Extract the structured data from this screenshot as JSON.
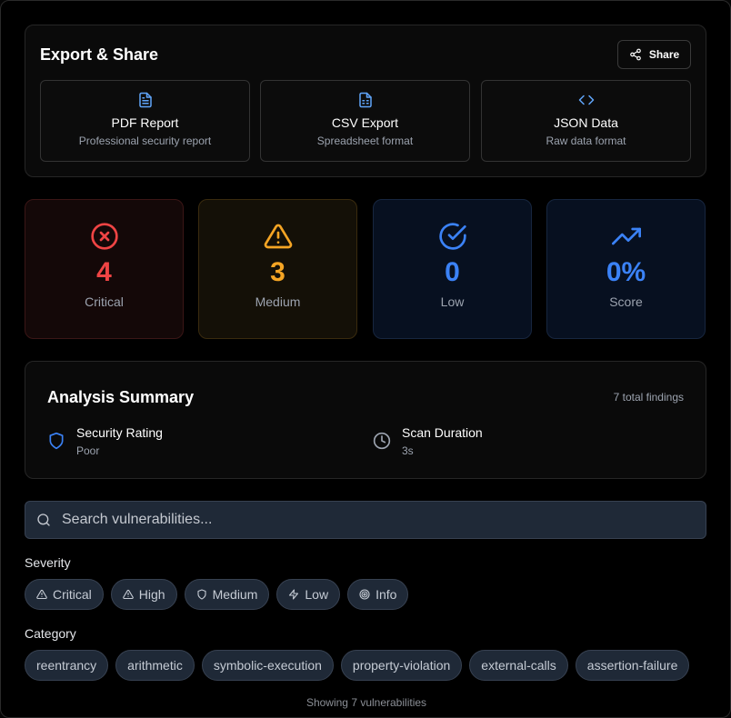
{
  "export": {
    "title": "Export & Share",
    "share_label": "Share",
    "options": [
      {
        "name": "PDF Report",
        "desc": "Professional security report",
        "icon": "file-text-icon"
      },
      {
        "name": "CSV Export",
        "desc": "Spreadsheet format",
        "icon": "file-spreadsheet-icon"
      },
      {
        "name": "JSON Data",
        "desc": "Raw data format",
        "icon": "code-icon"
      }
    ]
  },
  "stats": [
    {
      "value": "4",
      "label": "Critical",
      "color": "#ef4444",
      "icon": "x-circle-icon"
    },
    {
      "value": "3",
      "label": "Medium",
      "color": "#f5a524",
      "icon": "alert-triangle-icon"
    },
    {
      "value": "0",
      "label": "Low",
      "color": "#3b82f6",
      "icon": "check-circle-icon"
    },
    {
      "value": "0%",
      "label": "Score",
      "color": "#3b82f6",
      "icon": "trending-up-icon"
    }
  ],
  "summary": {
    "title": "Analysis Summary",
    "count": "7 total findings",
    "rating_label": "Security Rating",
    "rating_value": "Poor",
    "duration_label": "Scan Duration",
    "duration_value": "3s"
  },
  "search": {
    "placeholder": "Search vulnerabilities..."
  },
  "severity": {
    "label": "Severity",
    "items": [
      "Critical",
      "High",
      "Medium",
      "Low",
      "Info"
    ]
  },
  "category": {
    "label": "Category",
    "items": [
      "reentrancy",
      "arithmetic",
      "symbolic-execution",
      "property-violation",
      "external-calls",
      "assertion-failure"
    ]
  },
  "footer": "Showing 7 vulnerabilities"
}
